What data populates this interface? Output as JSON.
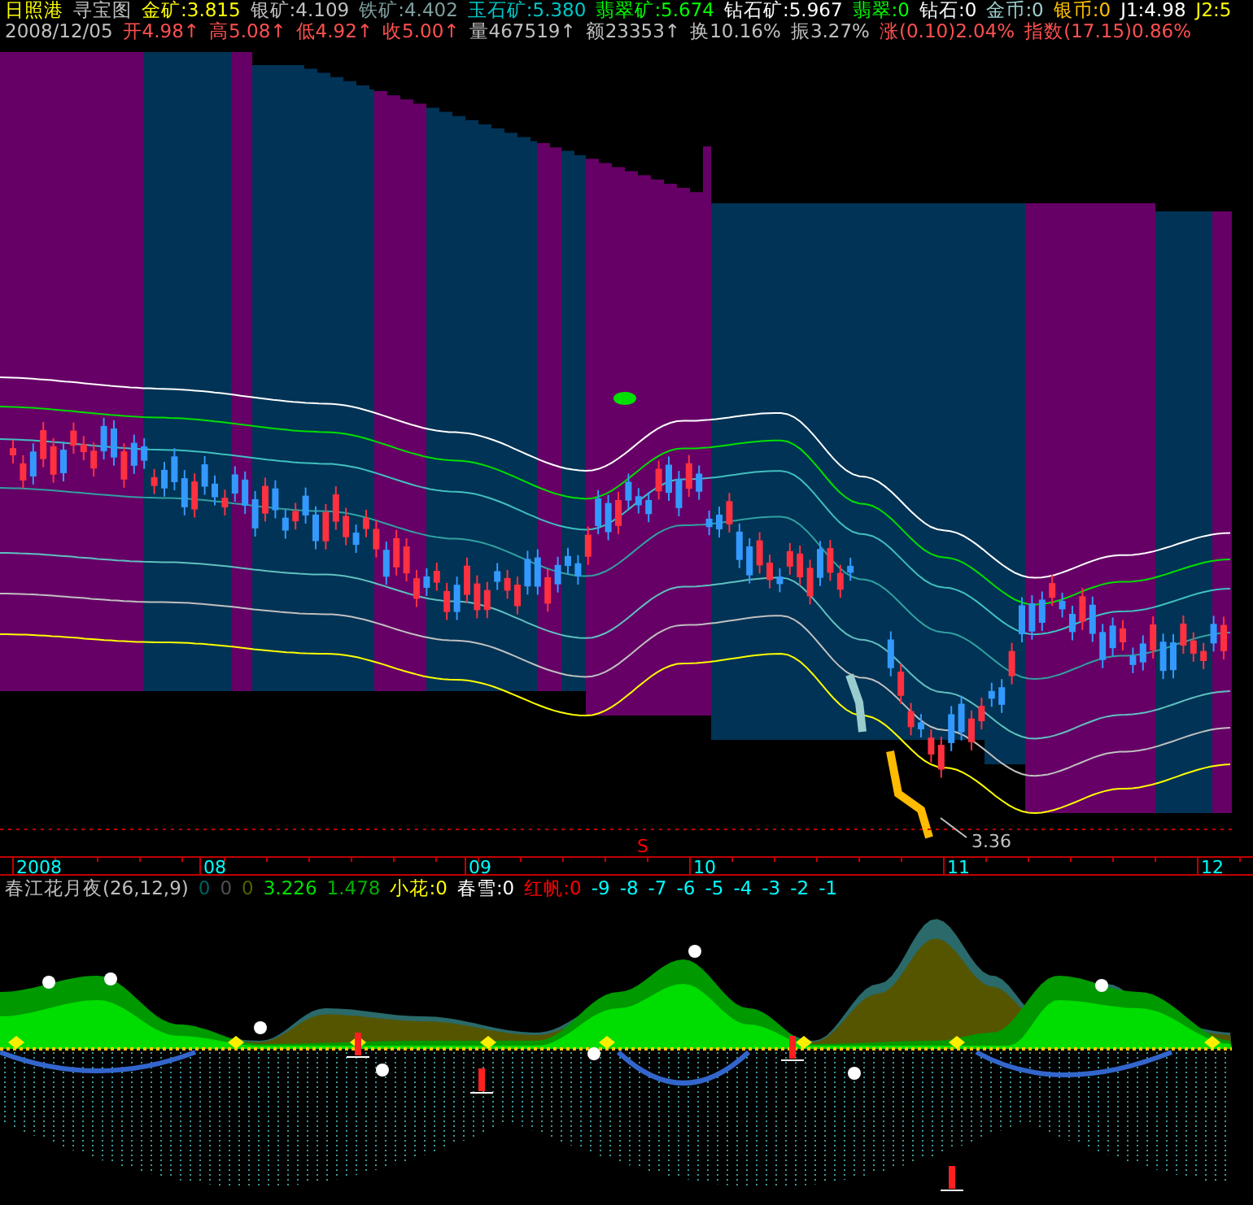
{
  "title_row": [
    {
      "text": "日照港",
      "color": "#ffff00"
    },
    {
      "text": "寻宝图",
      "color": "#c0c0c0"
    },
    {
      "text": "金矿:3.815",
      "color": "#ffff00"
    },
    {
      "text": "银矿:4.109",
      "color": "#c0c0c0"
    },
    {
      "text": "铁矿:4.402",
      "color": "#7f9f9f"
    },
    {
      "text": "玉石矿:5.380",
      "color": "#00c8c8"
    },
    {
      "text": "翡翠矿:5.674",
      "color": "#00ff00"
    },
    {
      "text": "钻石矿:5.967",
      "color": "#ffffff"
    },
    {
      "text": "翡翠:0",
      "color": "#00ff00"
    },
    {
      "text": "钻石:0",
      "color": "#ffffff"
    },
    {
      "text": "金币:0",
      "color": "#a0d0d0"
    },
    {
      "text": "银币:0",
      "color": "#ffc000"
    },
    {
      "text": "J1:4.98",
      "color": "#ffffff"
    },
    {
      "text": "J2:5",
      "color": "#ffff00"
    }
  ],
  "quote_row": [
    {
      "text": "2008/12/05",
      "color": "#c0c0c0"
    },
    {
      "text": "开4.98↑",
      "color": "#ff5050"
    },
    {
      "text": "高5.08↑",
      "color": "#ff5050"
    },
    {
      "text": "低4.92↑",
      "color": "#ff5050"
    },
    {
      "text": "收5.00↑",
      "color": "#ff5050"
    },
    {
      "text": "量467519↑",
      "color": "#c0c0c0"
    },
    {
      "text": "额23353↑",
      "color": "#c0c0c0"
    },
    {
      "text": "换10.16%",
      "color": "#c0c0c0"
    },
    {
      "text": "振3.27%",
      "color": "#c0c0c0"
    },
    {
      "text": "涨(0.10)2.04%",
      "color": "#ff5050"
    },
    {
      "text": "指数(17.15)0.86%",
      "color": "#ff5050"
    }
  ],
  "price_chart": {
    "signal_marker": "S",
    "price_label": "3.36"
  },
  "time_axis": [
    "2008",
    "08",
    "09",
    "10",
    "11",
    "12"
  ],
  "indicator_row": [
    {
      "text": "春江花月夜(26,12,9)",
      "color": "#c0c0c0"
    },
    {
      "text": "0",
      "color": "#006060"
    },
    {
      "text": "0",
      "color": "#505050"
    },
    {
      "text": "0",
      "color": "#506000"
    },
    {
      "text": "3.226",
      "color": "#00e000"
    },
    {
      "text": "1.478",
      "color": "#00b000"
    },
    {
      "text": "小花:0",
      "color": "#ffff00"
    },
    {
      "text": "春雪:0",
      "color": "#ffffff"
    },
    {
      "text": "红帆:0",
      "color": "#ff0000"
    },
    {
      "text": "-9",
      "color": "#00ffff"
    },
    {
      "text": "-8",
      "color": "#00ffff"
    },
    {
      "text": "-7",
      "color": "#00ffff"
    },
    {
      "text": "-6",
      "color": "#00ffff"
    },
    {
      "text": "-5",
      "color": "#00ffff"
    },
    {
      "text": "-4",
      "color": "#00ffff"
    },
    {
      "text": "-3",
      "color": "#00ffff"
    },
    {
      "text": "-2",
      "color": "#00ffff"
    },
    {
      "text": "-1",
      "color": "#00ffff"
    }
  ]
}
